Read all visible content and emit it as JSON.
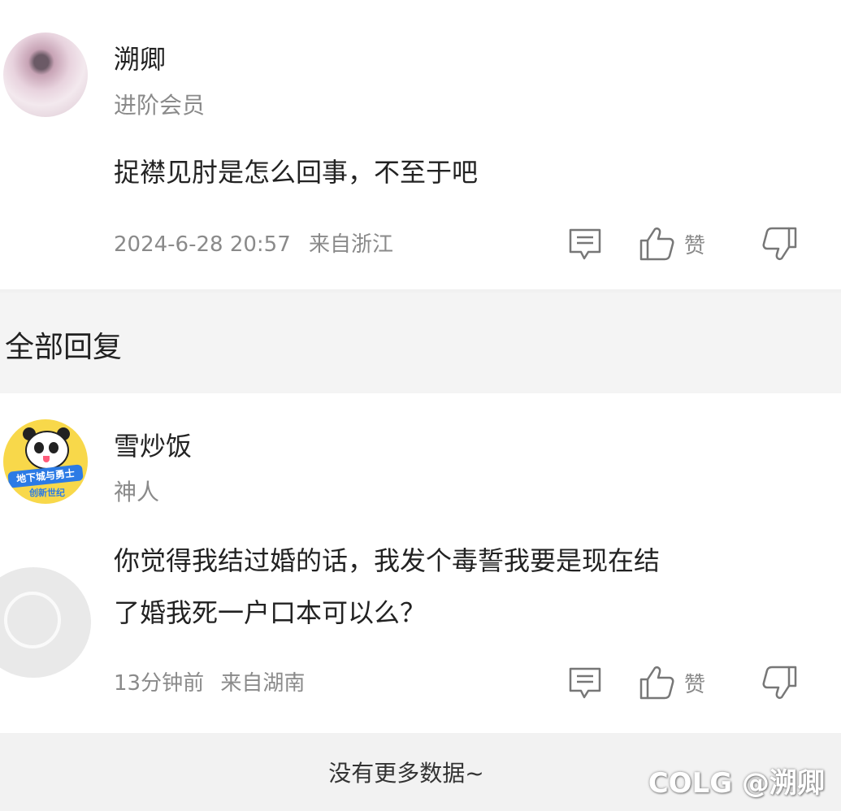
{
  "main_comment": {
    "username": "溯卿",
    "badge": "进阶会员",
    "content": "捉襟见肘是怎么回事，不至于吧",
    "timestamp": "2024-6-28 20:57",
    "location": "来自浙江",
    "like_label": "赞"
  },
  "replies_section": {
    "title": "全部回复"
  },
  "reply": {
    "username": "雪炒饭",
    "badge": "神人",
    "content_line1": "你觉得我结过婚的话，我发个毒誓我要是现在结",
    "content_line2": "了婚我死一户口本可以么？",
    "timestamp": "13分钟前",
    "location": "来自湖南",
    "like_label": "赞",
    "avatar_banner": "地下城与勇士",
    "avatar_sub": "创新世纪"
  },
  "footer": {
    "no_more": "没有更多数据~"
  },
  "watermark": "COLG @溯卿",
  "icons": [
    "comment-icon",
    "thumbs-up-icon",
    "thumbs-down-icon"
  ],
  "colors": {
    "text": "#222222",
    "muted": "#8a8a8a",
    "section_bg": "#f4f4f4"
  }
}
